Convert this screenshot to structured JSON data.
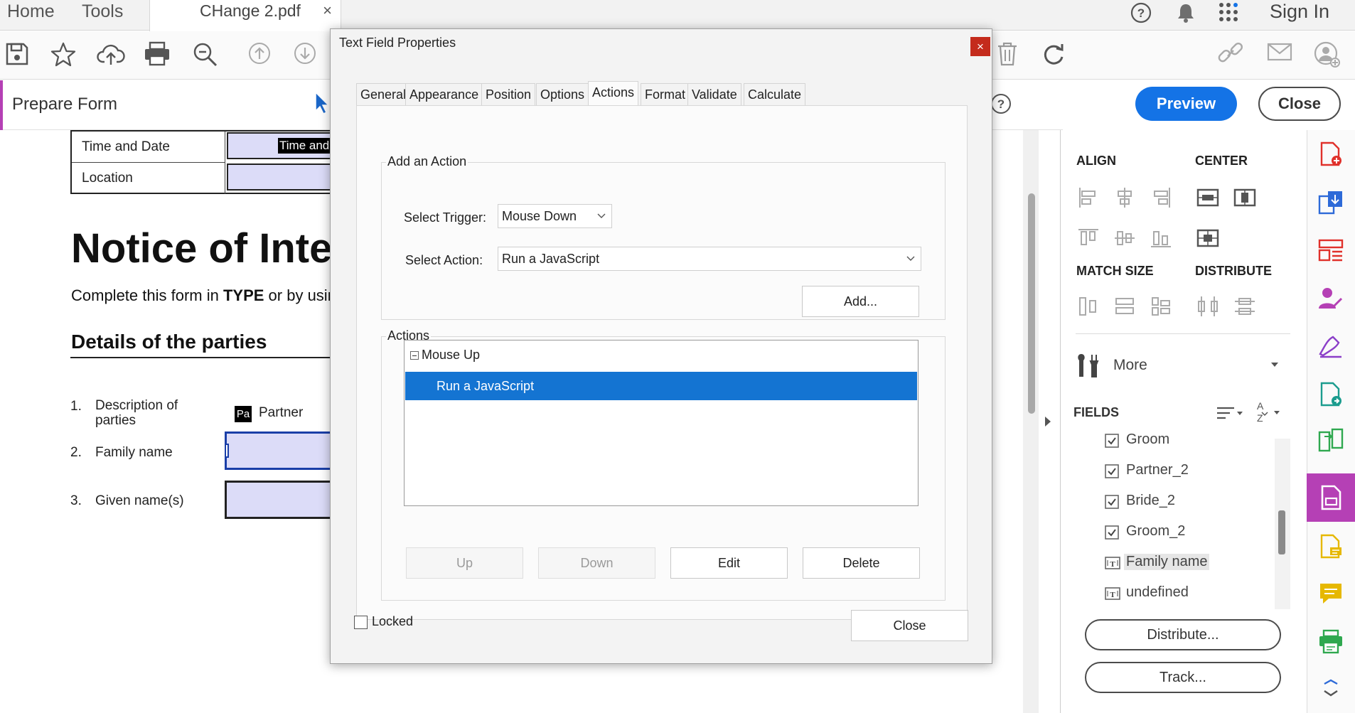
{
  "topbar": {
    "home": "Home",
    "tools": "Tools",
    "doc_tab": "CHange 2.pdf",
    "doc_tab_close": "×",
    "sign_in": "Sign In"
  },
  "prepare": {
    "title": "Prepare Form",
    "preview": "Preview",
    "close": "Close"
  },
  "document": {
    "table": [
      {
        "label": "Time and Date",
        "value": "Time and"
      },
      {
        "label": "Location",
        "value": ""
      }
    ],
    "title": "Notice of Inte",
    "instruction_pre": "Complete this form in ",
    "instruction_bold": "TYPE",
    "instruction_post": " or by usin",
    "section": "Details of the parties",
    "items": [
      {
        "num": "1.",
        "label": "Description of parties",
        "label_line1": "Description of",
        "label_line2": "parties"
      },
      {
        "num": "2.",
        "label": "Family name"
      },
      {
        "num": "3.",
        "label": "Given name(s)"
      }
    ],
    "tag": "Pa",
    "tag_label": "Partner"
  },
  "dialog": {
    "title": "Text Field Properties",
    "close_x": "×",
    "tabs": [
      "General",
      "Appearance",
      "Position",
      "Options",
      "Actions",
      "Format",
      "Validate",
      "Calculate"
    ],
    "active_tab": "Actions",
    "add_group": {
      "title": "Add an Action",
      "trigger_label": "Select Trigger:",
      "trigger_value": "Mouse Down",
      "action_label": "Select Action:",
      "action_value": "Run a JavaScript",
      "add_button": "Add..."
    },
    "actions_group": {
      "title": "Actions",
      "node": "Mouse Up",
      "selected_item": "Run a JavaScript",
      "buttons": {
        "up": "Up",
        "down": "Down",
        "edit": "Edit",
        "delete": "Delete"
      }
    },
    "locked_label": "Locked",
    "close_button": "Close"
  },
  "panel": {
    "align": "ALIGN",
    "center": "CENTER",
    "match_size": "MATCH SIZE",
    "distribute": "DISTRIBUTE",
    "more": "More",
    "fields": "FIELDS",
    "sort_label": "A Z",
    "field_items": [
      {
        "label": "Groom",
        "type": "checkbox"
      },
      {
        "label": "Partner_2",
        "type": "checkbox"
      },
      {
        "label": "Bride_2",
        "type": "checkbox"
      },
      {
        "label": "Groom_2",
        "type": "checkbox"
      },
      {
        "label": "Family name",
        "type": "textfield",
        "selected": true
      },
      {
        "label": "undefined",
        "type": "textfield"
      }
    ],
    "distribute_button": "Distribute...",
    "track_button": "Track..."
  },
  "colors": {
    "accent_purple": "#b540b5",
    "preview_blue": "#1473e6",
    "selection_blue": "#1474d2",
    "dialog_close_red": "#c42b1c",
    "field_fill": "#dcdcf8"
  }
}
